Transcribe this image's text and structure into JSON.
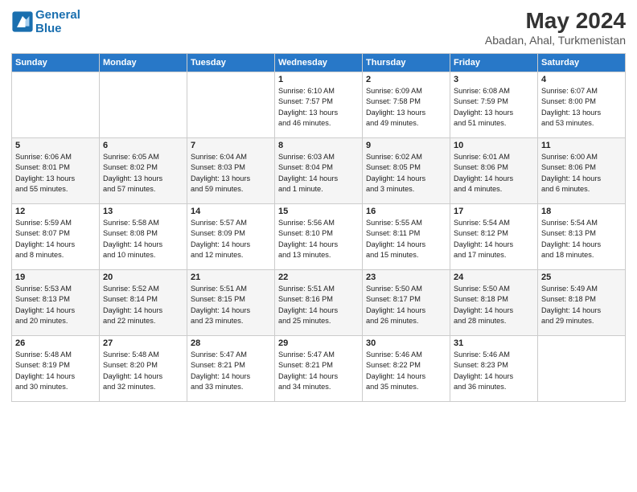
{
  "header": {
    "logo_line1": "General",
    "logo_line2": "Blue",
    "month_year": "May 2024",
    "location": "Abadan, Ahal, Turkmenistan"
  },
  "days_of_week": [
    "Sunday",
    "Monday",
    "Tuesday",
    "Wednesday",
    "Thursday",
    "Friday",
    "Saturday"
  ],
  "weeks": [
    [
      {
        "day": "",
        "info": ""
      },
      {
        "day": "",
        "info": ""
      },
      {
        "day": "",
        "info": ""
      },
      {
        "day": "1",
        "info": "Sunrise: 6:10 AM\nSunset: 7:57 PM\nDaylight: 13 hours\nand 46 minutes."
      },
      {
        "day": "2",
        "info": "Sunrise: 6:09 AM\nSunset: 7:58 PM\nDaylight: 13 hours\nand 49 minutes."
      },
      {
        "day": "3",
        "info": "Sunrise: 6:08 AM\nSunset: 7:59 PM\nDaylight: 13 hours\nand 51 minutes."
      },
      {
        "day": "4",
        "info": "Sunrise: 6:07 AM\nSunset: 8:00 PM\nDaylight: 13 hours\nand 53 minutes."
      }
    ],
    [
      {
        "day": "5",
        "info": "Sunrise: 6:06 AM\nSunset: 8:01 PM\nDaylight: 13 hours\nand 55 minutes."
      },
      {
        "day": "6",
        "info": "Sunrise: 6:05 AM\nSunset: 8:02 PM\nDaylight: 13 hours\nand 57 minutes."
      },
      {
        "day": "7",
        "info": "Sunrise: 6:04 AM\nSunset: 8:03 PM\nDaylight: 13 hours\nand 59 minutes."
      },
      {
        "day": "8",
        "info": "Sunrise: 6:03 AM\nSunset: 8:04 PM\nDaylight: 14 hours\nand 1 minute."
      },
      {
        "day": "9",
        "info": "Sunrise: 6:02 AM\nSunset: 8:05 PM\nDaylight: 14 hours\nand 3 minutes."
      },
      {
        "day": "10",
        "info": "Sunrise: 6:01 AM\nSunset: 8:06 PM\nDaylight: 14 hours\nand 4 minutes."
      },
      {
        "day": "11",
        "info": "Sunrise: 6:00 AM\nSunset: 8:06 PM\nDaylight: 14 hours\nand 6 minutes."
      }
    ],
    [
      {
        "day": "12",
        "info": "Sunrise: 5:59 AM\nSunset: 8:07 PM\nDaylight: 14 hours\nand 8 minutes."
      },
      {
        "day": "13",
        "info": "Sunrise: 5:58 AM\nSunset: 8:08 PM\nDaylight: 14 hours\nand 10 minutes."
      },
      {
        "day": "14",
        "info": "Sunrise: 5:57 AM\nSunset: 8:09 PM\nDaylight: 14 hours\nand 12 minutes."
      },
      {
        "day": "15",
        "info": "Sunrise: 5:56 AM\nSunset: 8:10 PM\nDaylight: 14 hours\nand 13 minutes."
      },
      {
        "day": "16",
        "info": "Sunrise: 5:55 AM\nSunset: 8:11 PM\nDaylight: 14 hours\nand 15 minutes."
      },
      {
        "day": "17",
        "info": "Sunrise: 5:54 AM\nSunset: 8:12 PM\nDaylight: 14 hours\nand 17 minutes."
      },
      {
        "day": "18",
        "info": "Sunrise: 5:54 AM\nSunset: 8:13 PM\nDaylight: 14 hours\nand 18 minutes."
      }
    ],
    [
      {
        "day": "19",
        "info": "Sunrise: 5:53 AM\nSunset: 8:13 PM\nDaylight: 14 hours\nand 20 minutes."
      },
      {
        "day": "20",
        "info": "Sunrise: 5:52 AM\nSunset: 8:14 PM\nDaylight: 14 hours\nand 22 minutes."
      },
      {
        "day": "21",
        "info": "Sunrise: 5:51 AM\nSunset: 8:15 PM\nDaylight: 14 hours\nand 23 minutes."
      },
      {
        "day": "22",
        "info": "Sunrise: 5:51 AM\nSunset: 8:16 PM\nDaylight: 14 hours\nand 25 minutes."
      },
      {
        "day": "23",
        "info": "Sunrise: 5:50 AM\nSunset: 8:17 PM\nDaylight: 14 hours\nand 26 minutes."
      },
      {
        "day": "24",
        "info": "Sunrise: 5:50 AM\nSunset: 8:18 PM\nDaylight: 14 hours\nand 28 minutes."
      },
      {
        "day": "25",
        "info": "Sunrise: 5:49 AM\nSunset: 8:18 PM\nDaylight: 14 hours\nand 29 minutes."
      }
    ],
    [
      {
        "day": "26",
        "info": "Sunrise: 5:48 AM\nSunset: 8:19 PM\nDaylight: 14 hours\nand 30 minutes."
      },
      {
        "day": "27",
        "info": "Sunrise: 5:48 AM\nSunset: 8:20 PM\nDaylight: 14 hours\nand 32 minutes."
      },
      {
        "day": "28",
        "info": "Sunrise: 5:47 AM\nSunset: 8:21 PM\nDaylight: 14 hours\nand 33 minutes."
      },
      {
        "day": "29",
        "info": "Sunrise: 5:47 AM\nSunset: 8:21 PM\nDaylight: 14 hours\nand 34 minutes."
      },
      {
        "day": "30",
        "info": "Sunrise: 5:46 AM\nSunset: 8:22 PM\nDaylight: 14 hours\nand 35 minutes."
      },
      {
        "day": "31",
        "info": "Sunrise: 5:46 AM\nSunset: 8:23 PM\nDaylight: 14 hours\nand 36 minutes."
      },
      {
        "day": "",
        "info": ""
      }
    ]
  ]
}
